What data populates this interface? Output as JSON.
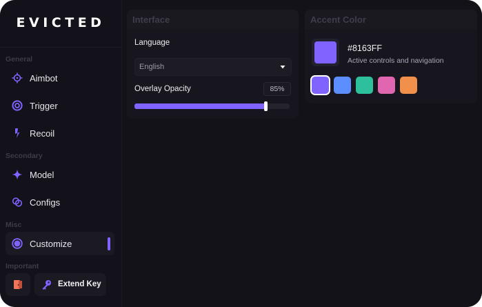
{
  "app": {
    "title": "EVICTED"
  },
  "sidebar": {
    "sections": [
      {
        "label": "General"
      },
      {
        "label": "Secondary"
      },
      {
        "label": "Misc"
      },
      {
        "label": "Important"
      }
    ],
    "items": [
      {
        "label": "Aimbot",
        "icon": "crosshair-icon"
      },
      {
        "label": "Trigger",
        "icon": "target-ring-icon"
      },
      {
        "label": "Recoil",
        "icon": "bolt-icon"
      },
      {
        "label": "Model",
        "icon": "sparkle-icon"
      },
      {
        "label": "Configs",
        "icon": "link-circles-icon"
      },
      {
        "label": "Customize",
        "icon": "palette-circle-icon",
        "active": true
      }
    ],
    "logout_icon": "logout-door-icon",
    "extend_key": {
      "label": "Extend Key",
      "icon": "key-icon"
    }
  },
  "interface_card": {
    "title": "Interface",
    "language_label": "Language",
    "language_value": "English",
    "opacity_label": "Overlay Opacity",
    "opacity_value_text": "85%",
    "opacity_value": 85
  },
  "accent_card": {
    "title": "Accent Color",
    "current_hex": "#8163FF",
    "description": "Active controls and navigation",
    "swatches": [
      {
        "color": "#8163ff",
        "selected": true
      },
      {
        "color": "#5c8eff",
        "selected": false
      },
      {
        "color": "#2ebf9c",
        "selected": false
      },
      {
        "color": "#e066b0",
        "selected": false
      },
      {
        "color": "#f0904a",
        "selected": false
      }
    ]
  },
  "colors": {
    "accent": "#8163ff",
    "background": "#131219",
    "panel": "#17161e"
  }
}
